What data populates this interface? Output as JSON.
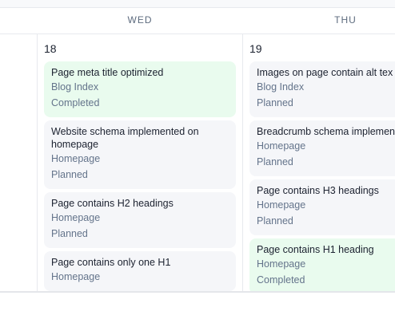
{
  "days": [
    {
      "header": "WED",
      "number": "18"
    },
    {
      "header": "THU",
      "number": "19"
    }
  ],
  "wed_cards": [
    {
      "title": "Page meta title optimized",
      "page": "Blog Index",
      "status": "Completed"
    },
    {
      "title": "Website schema implemented on homepage",
      "page": "Homepage",
      "status": "Planned"
    },
    {
      "title": "Page contains H2 headings",
      "page": "Homepage",
      "status": "Planned"
    },
    {
      "title": "Page contains only one H1",
      "page": "Homepage",
      "status": ""
    }
  ],
  "thu_cards": [
    {
      "title": "Images on page contain alt tex",
      "page": "Blog Index",
      "status": "Planned"
    },
    {
      "title": "Breadcrumb schema implemen",
      "page": "Homepage",
      "status": "Planned"
    },
    {
      "title": "Page contains H3 headings",
      "page": "Homepage",
      "status": "Planned"
    },
    {
      "title": "Page contains H1 heading",
      "page": "Homepage",
      "status": "Completed"
    }
  ],
  "colors": {
    "completed_bg": "#e9fbee",
    "planned_bg": "#f5f6f9",
    "text_primary": "#1c2230",
    "text_muted": "#64748b"
  }
}
